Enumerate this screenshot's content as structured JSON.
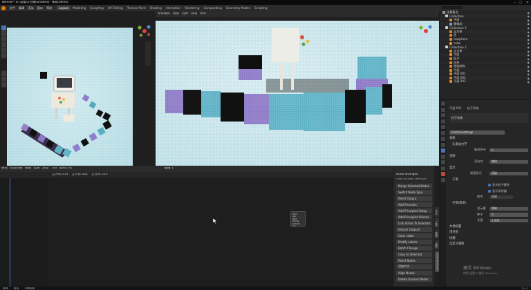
{
  "window": {
    "title": "Blender* [E:\\渲染\\小白模\\untitled] - 新建.blend]"
  },
  "top_menu": [
    "文件",
    "编辑",
    "渲染",
    "窗口",
    "帮助"
  ],
  "workspaces": {
    "tabs": [
      "Layout",
      "Modeling",
      "Sculpting",
      "UV Editing",
      "Texture Paint",
      "Shading",
      "Animation",
      "Rendering",
      "Compositing",
      "Geometry Nodes",
      "Scripting"
    ],
    "active": "Layout"
  },
  "scene": {
    "scene_name": "Scene",
    "view_layer": "ViewLayer"
  },
  "outliner": {
    "items": [
      {
        "name": "场景集合",
        "color": "#9a9a9a"
      },
      {
        "name": "Collection",
        "color": "#cfcfcf"
      },
      {
        "name": "平面",
        "color": "#e08a2e"
      },
      {
        "name": "摄像机",
        "color": "#7aa0d6"
      },
      {
        "name": "Collection 3",
        "color": "#cfcfcf"
      },
      {
        "name": "立方体",
        "color": "#e08a2e"
      },
      {
        "name": "无",
        "color": "#e08a2e"
      },
      {
        "name": "Icosphere",
        "color": "#e08a2e"
      },
      {
        "name": "cube",
        "color": "#e08a2e"
      },
      {
        "name": "Collection 2",
        "color": "#cfcfcf"
      },
      {
        "name": "立方体",
        "color": "#e08a2e"
      },
      {
        "name": "平面",
        "color": "#e08a2e"
      },
      {
        "name": "粒子",
        "color": "#e08a2e"
      },
      {
        "name": "白色",
        "color": "#e08a2e"
      },
      {
        "name": "相机结构",
        "color": "#e08a2e"
      },
      {
        "name": "平面",
        "color": "#e08a2e"
      },
      {
        "name": "平面.001",
        "color": "#e08a2e"
      },
      {
        "name": "平面.002",
        "color": "#e08a2e"
      },
      {
        "name": "平面.003",
        "color": "#e08a2e"
      }
    ]
  },
  "properties": {
    "breadcrumb_obj": "平面.001",
    "breadcrumb_sys": "粒子系统",
    "particle_system": "粒子系统",
    "settings_name": "ParticleSettings",
    "emission": "发射",
    "seed_label": "随机种子",
    "seed_value": "0",
    "hair_dynamics": "头发动力学",
    "render": "渲染",
    "render_as_label": "渲染为",
    "render_as_value": "物体",
    "display": "显示",
    "display_label": "视图显示",
    "display_value": "渲染",
    "children": "子项",
    "hair_shape": "头发形状",
    "cb1": "显示粒子属性",
    "cb2": "显示发射器",
    "color_label": "颜色",
    "color_value": "材质",
    "children_section": "子项(简单)",
    "children_mode_label": "显示量",
    "children_mode_value": "简单",
    "seed2_label": "种子",
    "seed2_value": "0",
    "length_label": "长度",
    "length_value": "1.000",
    "field_weights": "力场权重",
    "vertex_groups": "顶点组",
    "textures": "纹理",
    "custom_props": "自定义属性"
  },
  "viewport_right": {
    "mode_label": "物体模式",
    "view_label": "视图",
    "select_label": "选择",
    "add_label": "添加",
    "object_label": "物体"
  },
  "node_editor": {
    "header_items": [
      "物体",
      "新建材质",
      "视图",
      "选择",
      "添加",
      "节点",
      "使用节点"
    ],
    "sub_items": [
      "立方体.013",
      "立方体.002",
      "立方体.013"
    ],
    "slot_label": "插槽 1"
  },
  "node_popup": {
    "items": [
      "Vibra",
      "Lab",
      "Mult",
      "VNode",
      "ReNode",
      "Glo"
    ]
  },
  "node_wrangler": {
    "title": "Node Wrangler",
    "subtitle": "Clear Unused: Shift+Del",
    "buttons": [
      "Merge Selected Nodes",
      "Switch Node Type",
      "Reset Output",
      "Add Reroutes",
      "Add Principled Setup",
      "Add Principled Volume",
      "Link Active To Selected",
      "Detach Outputs",
      "Color Label",
      "Modify Labels",
      "Batch Change",
      "Copy to Selected",
      "Reset Nodes",
      "添加节点",
      "Align Nodes",
      "Delete Unused Nodes"
    ],
    "tabs": [
      "节点",
      "工具",
      "视图",
      "选项",
      "Node Wrangler"
    ]
  },
  "status_bar": {
    "left": "选择",
    "mid": "框选",
    "right": "平移视图",
    "version": "3.4.1"
  },
  "watermark": {
    "line1": "激活 Windows",
    "line2": "转到\"设置\"以激活 Windows。"
  }
}
